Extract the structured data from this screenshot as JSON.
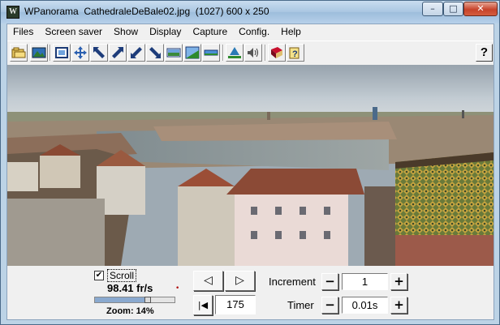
{
  "window": {
    "title": "WPanorama  CathedraleDeBale02.jpg  (1027) 600 x 250",
    "app_icon_letter": "W",
    "minimize_glyph": "–",
    "maximize_glyph": "□",
    "close_glyph": "✕"
  },
  "menu": [
    {
      "label": "Files"
    },
    {
      "label": "Screen saver"
    },
    {
      "label": "Show"
    },
    {
      "label": "Display"
    },
    {
      "label": "Capture"
    },
    {
      "label": "Config."
    },
    {
      "label": "Help"
    }
  ],
  "toolbar": {
    "buttons": [
      {
        "icon": "open-icon",
        "glyph": "📂"
      },
      {
        "icon": "picture-icon",
        "glyph": "▣"
      },
      {
        "icon": "fullscreen-icon",
        "glyph": "▢"
      },
      {
        "icon": "move-icon",
        "glyph": "✥"
      },
      {
        "icon": "arrow-up-left-icon",
        "glyph": "↖"
      },
      {
        "icon": "arrow-up-right-icon",
        "glyph": "↗"
      },
      {
        "icon": "arrow-down-left-icon",
        "glyph": "↙"
      },
      {
        "icon": "arrow-down-right-icon",
        "glyph": "↘"
      },
      {
        "icon": "display-panorama-icon",
        "glyph": "▭"
      },
      {
        "icon": "landscape-icon",
        "glyph": "◢"
      },
      {
        "icon": "strip-icon",
        "glyph": "▬"
      },
      {
        "icon": "play-icon",
        "glyph": "▲"
      },
      {
        "icon": "sound-icon",
        "glyph": "🔊"
      },
      {
        "icon": "book-icon",
        "glyph": "📖"
      },
      {
        "icon": "help-book-icon",
        "glyph": "?"
      }
    ],
    "help_label": "?"
  },
  "controls": {
    "scroll_label": "Scroll",
    "scroll_checked": true,
    "check_glyph": "✔",
    "fps": "98.41 fr/s",
    "fps_icon_glyph": "•",
    "zoom_label": "Zoom: 14%",
    "zoom_fraction": 0.14,
    "nav_prev_glyph": "◁",
    "nav_next_glyph": "▷",
    "nav_first_glyph": "|◀",
    "position_value": "175",
    "increment_label": "Increment",
    "increment_value": "1",
    "timer_label": "Timer",
    "timer_value": "0.01s",
    "minus_glyph": "−",
    "plus_glyph": "+"
  },
  "colors": {
    "titlebar": "#a9c6e2",
    "close_button": "#c7432a",
    "zoom_fill": "#8aa9cf"
  }
}
